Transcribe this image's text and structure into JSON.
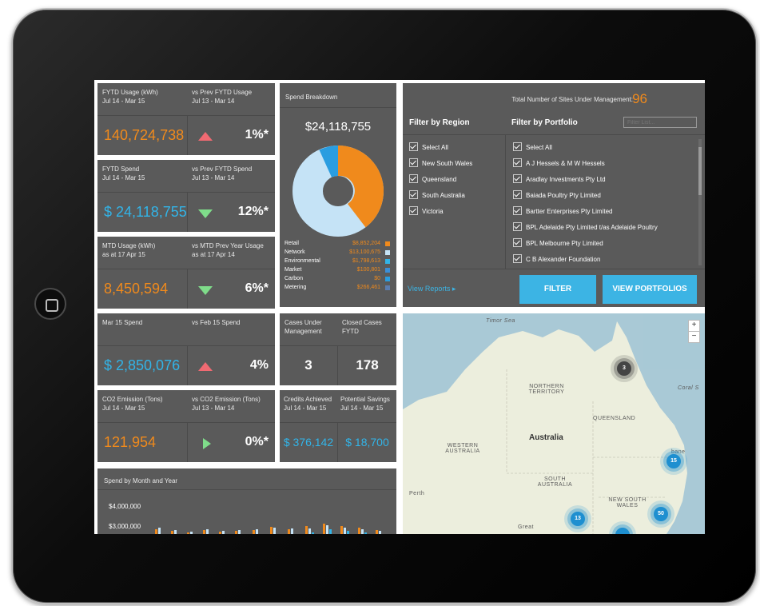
{
  "kpi": {
    "fytd_usage": {
      "title1": "FYTD Usage (kWh)",
      "title1b": "Jul 14 - Mar 15",
      "title2": "vs Prev FYTD Usage",
      "title2b": "Jul 13 - Mar 14",
      "value": "140,724,738",
      "pct": "1%*"
    },
    "fytd_spend": {
      "title1": "FYTD Spend",
      "title1b": "Jul 14 - Mar 15",
      "title2": "vs Prev FYTD Spend",
      "title2b": "Jul 13 - Mar 14",
      "value": "$ 24,118,755",
      "pct": "12%*"
    },
    "mtd_usage": {
      "title1": "MTD Usage (kWh)",
      "title1b": "as at 17 Apr 15",
      "title2": "vs MTD Prev Year Usage",
      "title2b": "as at 17 Apr 14",
      "value": "8,450,594",
      "pct": "6%*"
    },
    "mar_spend": {
      "title1": "Mar 15 Spend",
      "title2": "vs Feb 15 Spend",
      "value": "$ 2,850,076",
      "pct": "4%"
    },
    "co2": {
      "title1": "CO2 Emission (Tons)",
      "title1b": "Jul 14 - Mar 15",
      "title2": "vs CO2 Emission (Tons)",
      "title2b": "Jul 13 - Mar 14",
      "value": "121,954",
      "pct": "0%*"
    }
  },
  "spend_breakdown": {
    "title": "Spend Breakdown",
    "total": "$24,118,755",
    "items": [
      {
        "label": "Retail",
        "value": "$8,852,204",
        "color": "#f08a1c"
      },
      {
        "label": "Network",
        "value": "$13,100,675",
        "color": "#c5e3f6"
      },
      {
        "label": "Environmental",
        "value": "$1,798,613",
        "color": "#32b4e8"
      },
      {
        "label": "Market",
        "value": "$100,801",
        "color": "#3a8fd8"
      },
      {
        "label": "Carbon",
        "value": "$0",
        "color": "#2a9de0"
      },
      {
        "label": "Metering",
        "value": "$266,461",
        "color": "#5a7db0"
      }
    ]
  },
  "cases": {
    "title1": "Cases Under Management",
    "title2": "Closed Cases FYTD",
    "value1": "3",
    "value2": "178"
  },
  "credits": {
    "title1": "Credits Achieved",
    "title1b": "Jul 14 - Mar 15",
    "title2": "Potential Savings",
    "title2b": "Jul 14 - Mar 15",
    "value1": "$ 376,142",
    "value2": "$ 18,700"
  },
  "spend_by_month": {
    "title": "Spend by Month and Year",
    "y_labels": [
      "$4,000,000",
      "$3,000,000"
    ]
  },
  "sites": {
    "label": "Total Number of Sites Under Management:",
    "count": "96"
  },
  "filter_region": {
    "title": "Filter by Region",
    "items": [
      "Select All",
      "New South Wales",
      "Queensland",
      "South Australia",
      "Victoria"
    ]
  },
  "filter_portfolio": {
    "title": "Filter by Portfolio",
    "placeholder": "Filter List...",
    "items": [
      "Select All",
      "A J Hessels & M W Hessels",
      "Aradlay Investments Pty Ltd",
      "Baiada Poultry Pty Limited",
      "Bartter Enterprises Pty Limited",
      "BPL Adelaide Pty Limited t/as Adelaide Poultry",
      "BPL Melbourne Pty Limited",
      "C B Alexander Foundation"
    ]
  },
  "actions": {
    "view_reports": "View Reports",
    "filter": "FILTER",
    "view_portfolios": "VIEW PORTFOLIOS"
  },
  "map": {
    "labels": {
      "timor": "Timor Sea",
      "nt": "NORTHERN TERRITORY",
      "qld": "QUEENSLAND",
      "aus": "Australia",
      "wa": "WESTERN AUSTRALIA",
      "sa": "SOUTH AUSTRALIA",
      "nsw": "NEW SOUTH WALES",
      "perth": "Perth",
      "coral": "Coral S",
      "brisbane": "bane",
      "great": "Great"
    },
    "clusters": {
      "c3": "3",
      "c15": "15",
      "c13": "13",
      "c50": "50"
    },
    "zoom_in": "+",
    "zoom_out": "−"
  }
}
